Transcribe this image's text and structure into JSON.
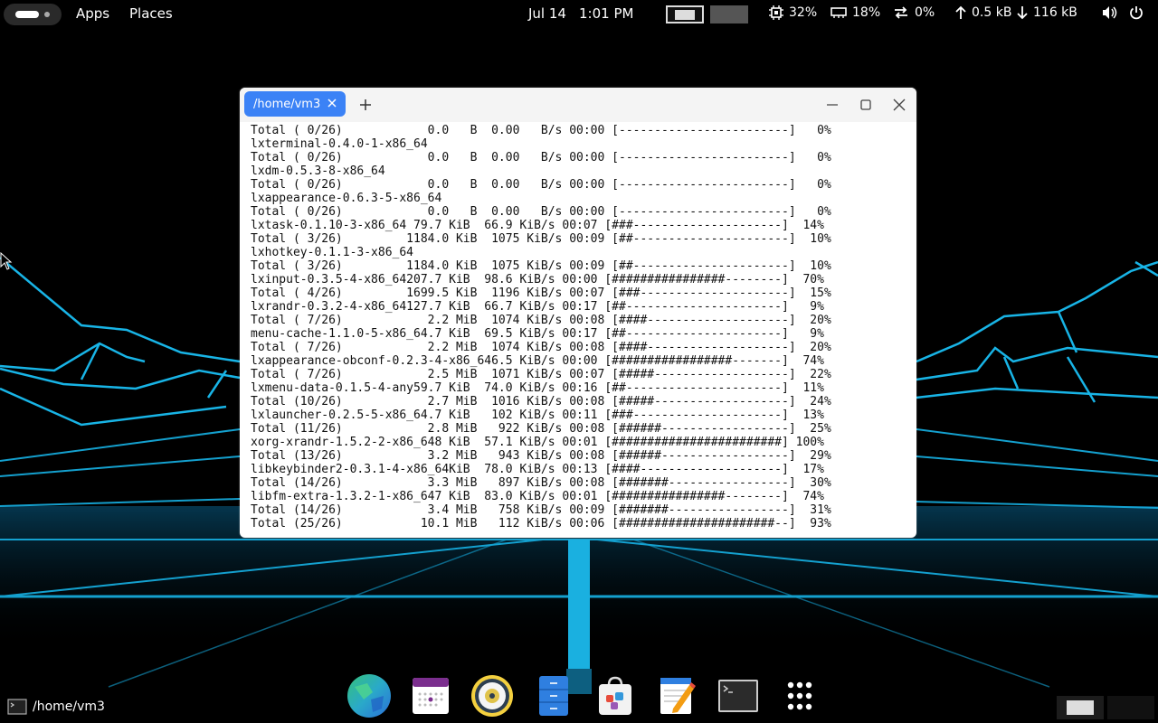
{
  "topbar": {
    "apps": "Apps",
    "places": "Places",
    "date": "Jul 14",
    "time": "1:01 PM",
    "cpu": "32%",
    "memory": "18%",
    "swap": "0%",
    "upload": "0.5 kB",
    "download": "116 kB"
  },
  "window": {
    "tab_title": "/home/vm3",
    "lines": [
      "Total ( 0/26)            0.0   B  0.00   B/s 00:00 [------------------------]   0%",
      "lxterminal-0.4.0-1-x86_64",
      "Total ( 0/26)            0.0   B  0.00   B/s 00:00 [------------------------]   0%",
      "lxdm-0.5.3-8-x86_64",
      "Total ( 0/26)            0.0   B  0.00   B/s 00:00 [------------------------]   0%",
      "lxappearance-0.6.3-5-x86_64",
      "Total ( 0/26)            0.0   B  0.00   B/s 00:00 [------------------------]   0%",
      "lxtask-0.1.10-3-x86_64 79.7 KiB  66.9 KiB/s 00:07 [###---------------------]  14%",
      "Total ( 3/26)         1184.0 KiB  1075 KiB/s 00:09 [##----------------------]  10%",
      "lxhotkey-0.1.1-3-x86_64",
      "Total ( 3/26)         1184.0 KiB  1075 KiB/s 00:09 [##----------------------]  10%",
      "lxinput-0.3.5-4-x86_64207.7 KiB  98.6 KiB/s 00:00 [################--------]  70%",
      "Total ( 4/26)         1699.5 KiB  1196 KiB/s 00:07 [###---------------------]  15%",
      "lxrandr-0.3.2-4-x86_64127.7 KiB  66.7 KiB/s 00:17 [##----------------------]   9%",
      "Total ( 7/26)            2.2 MiB  1074 KiB/s 00:08 [####--------------------]  20%",
      "menu-cache-1.1.0-5-x86_64.7 KiB  69.5 KiB/s 00:17 [##----------------------]   9%",
      "Total ( 7/26)            2.2 MiB  1074 KiB/s 00:08 [####--------------------]  20%",
      "lxappearance-obconf-0.2.3-4-x86_646.5 KiB/s 00:00 [#################-------]  74%",
      "Total ( 7/26)            2.5 MiB  1071 KiB/s 00:07 [#####-------------------]  22%",
      "lxmenu-data-0.1.5-4-any59.7 KiB  74.0 KiB/s 00:16 [##----------------------]  11%",
      "Total (10/26)            2.7 MiB  1016 KiB/s 00:08 [#####-------------------]  24%",
      "lxlauncher-0.2.5-5-x86_64.7 KiB   102 KiB/s 00:11 [###---------------------]  13%",
      "Total (11/26)            2.8 MiB   922 KiB/s 00:08 [######------------------]  25%",
      "xorg-xrandr-1.5.2-2-x86_648 KiB  57.1 KiB/s 00:01 [########################] 100%",
      "Total (13/26)            3.2 MiB   943 KiB/s 00:08 [######------------------]  29%",
      "libkeybinder2-0.3.1-4-x86_64KiB  78.0 KiB/s 00:13 [####--------------------]  17%",
      "Total (14/26)            3.3 MiB   897 KiB/s 00:08 [#######-----------------]  30%",
      "libfm-extra-1.3.2-1-x86_647 KiB  83.0 KiB/s 00:01 [################--------]  74%",
      "Total (14/26)            3.4 MiB   758 KiB/s 00:09 [#######-----------------]  31%",
      "Total (25/26)           10.1 MiB   112 KiB/s 00:06 [######################--]  93%"
    ]
  },
  "dock": {
    "items": [
      "browser",
      "calendar",
      "music-player",
      "file-manager",
      "software-store",
      "text-editor",
      "terminal",
      "app-grid"
    ]
  },
  "bottombar": {
    "window_title": "/home/vm3"
  },
  "colors": {
    "accent": "#3b82f6",
    "neon": "#1fb8e8"
  }
}
